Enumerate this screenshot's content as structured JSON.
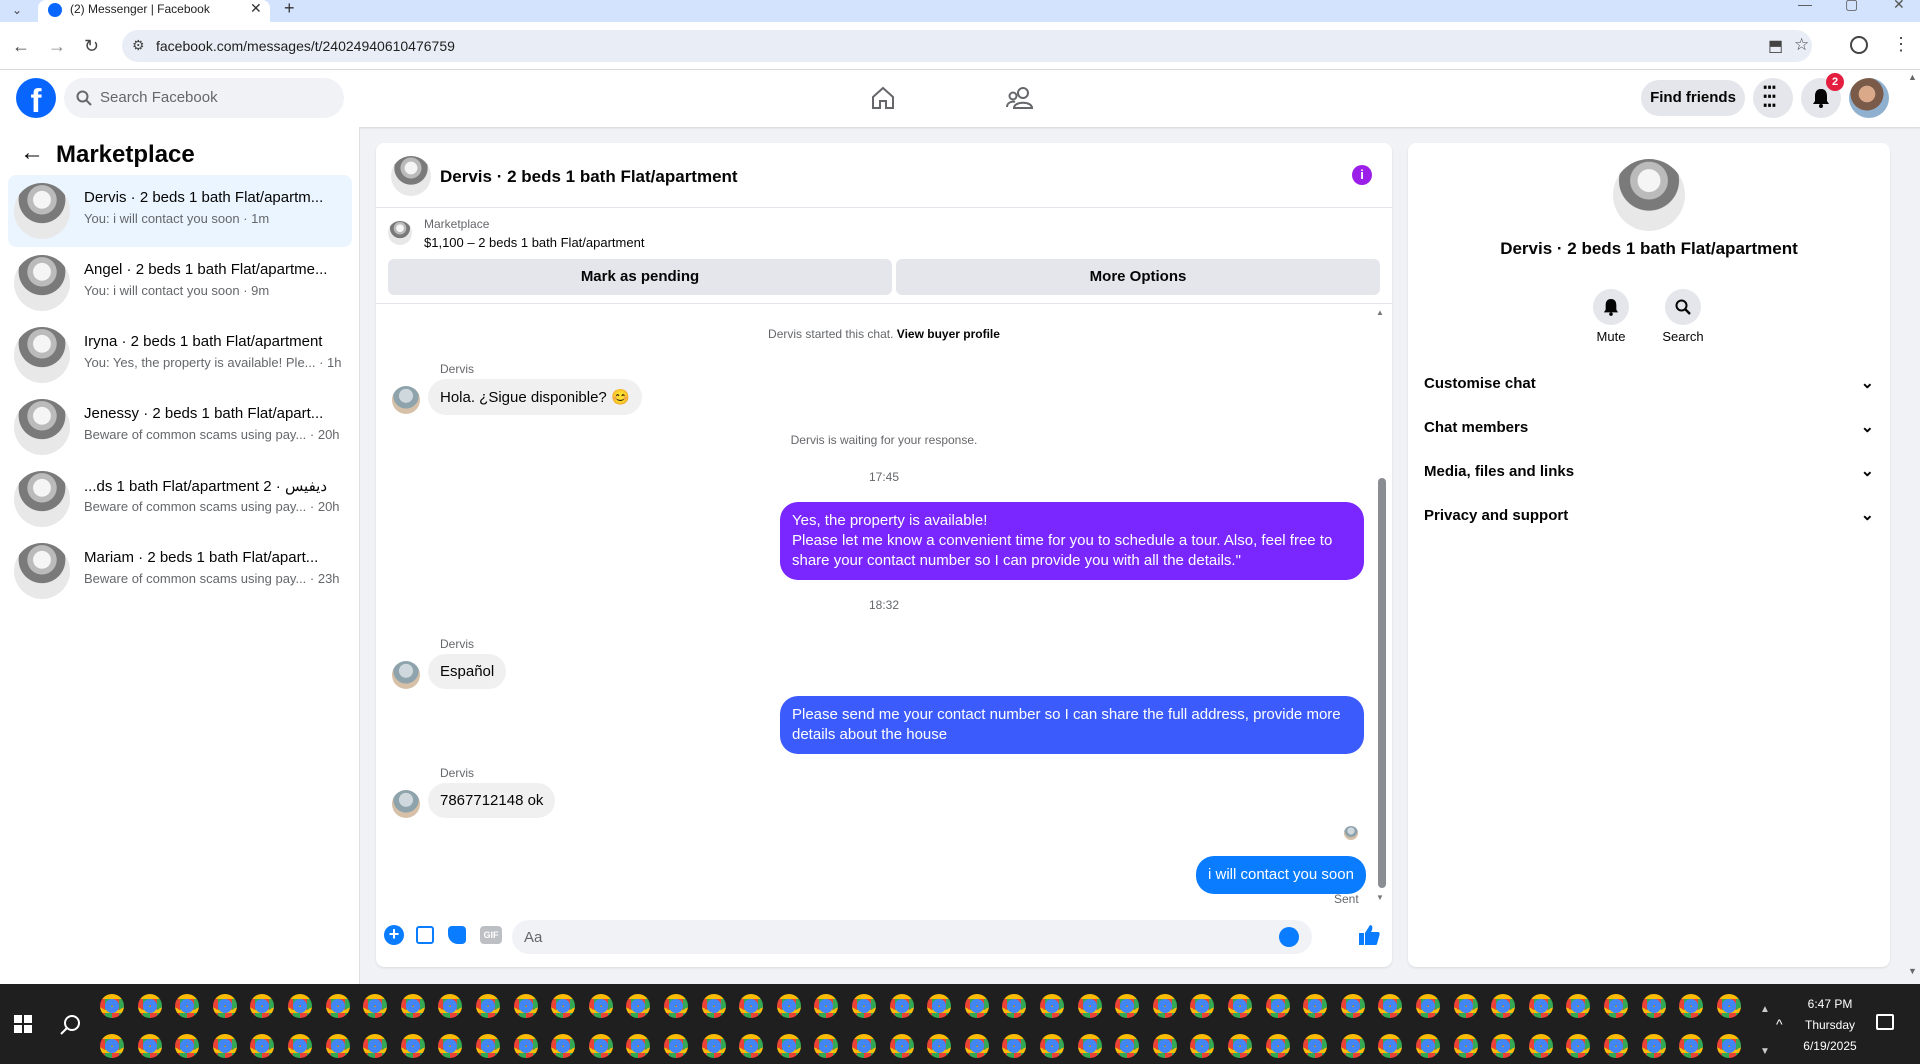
{
  "browser": {
    "tab_title": "(2) Messenger | Facebook",
    "url": "facebook.com/messages/t/24024940610476759"
  },
  "fb_header": {
    "search_placeholder": "Search Facebook",
    "find_friends": "Find friends",
    "notification_count": "2"
  },
  "left": {
    "title": "Marketplace",
    "conversations": [
      {
        "name": "Dervis · 2 beds 1 bath Flat/apartm...",
        "preview": "You: i will contact you soon · 1m"
      },
      {
        "name": "Angel · 2 beds 1 bath Flat/apartme...",
        "preview": "You: i will contact you soon · 9m"
      },
      {
        "name": "Iryna · 2 beds 1 bath Flat/apartment",
        "preview": "You: Yes, the property is available! Ple...  · 1h"
      },
      {
        "name": "Jenessy · 2 beds 1 bath Flat/apart...",
        "preview": "Beware of common scams using pay... · 20h"
      },
      {
        "name": "...ds 1 bath Flat/apartment 2 · ديفيس",
        "preview": "Beware of common scams using pay... · 20h"
      },
      {
        "name": "Mariam · 2 beds 1 bath Flat/apart...",
        "preview": "Beware of common scams using pay... · 23h"
      }
    ]
  },
  "chat": {
    "title": "Dervis · 2 beds 1 bath Flat/apartment",
    "listing_source": "Marketplace",
    "listing_title": "$1,100 – 2 beds 1 bath Flat/apartment",
    "mark_pending": "Mark as pending",
    "more_options": "More Options",
    "started_text": "Dervis started this chat.",
    "view_profile": "View buyer profile",
    "sender": "Dervis",
    "msg1": "Hola. ¿Sigue disponible? 😊",
    "waiting": "Dervis is waiting for your response.",
    "time1": "17:45",
    "msg2_line1": "Yes, the property is available!",
    "msg2_line2": "Please let me know a convenient time for you to schedule a tour. Also, feel free to share your contact number so I can provide you with all the details.\"",
    "time2": "18:32",
    "msg3": "Español",
    "msg4": "Please send me your contact number so I can share the full address, provide more details about the house",
    "msg5": "7867712148 ok",
    "msg6": "i will contact you soon",
    "sent": "Sent",
    "composer_placeholder": "Aa",
    "colors": {
      "purple": "#7a26ff",
      "blue": "#3b5bfd",
      "messenger_blue": "#0a7cff"
    }
  },
  "right": {
    "title": "Dervis · 2 beds 1 bath Flat/apartment",
    "mute": "Mute",
    "search": "Search",
    "menu": [
      "Customise chat",
      "Chat members",
      "Media, files and links",
      "Privacy and support"
    ]
  },
  "taskbar": {
    "time": "6:47 PM",
    "day": "Thursday",
    "date": "6/19/2025"
  }
}
